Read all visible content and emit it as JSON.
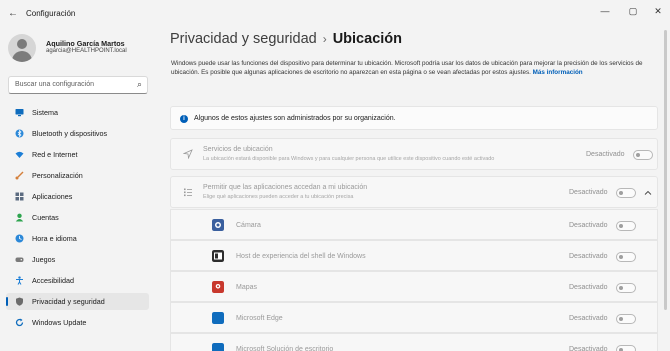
{
  "window": {
    "title": "Configuración",
    "back_icon": "←",
    "minimize": "—",
    "maximize": "▢",
    "close": "✕"
  },
  "user": {
    "name": "Aquilino García Martos",
    "email": "agarcia@HEALTHPOINT.local"
  },
  "search": {
    "placeholder": "Buscar una configuración",
    "icon": "⌕"
  },
  "nav": {
    "items": [
      {
        "label": "Sistema",
        "icon": "system-icon",
        "color": "#0f6cbd"
      },
      {
        "label": "Bluetooth y dispositivos",
        "icon": "bluetooth-icon",
        "color": "#2b88d8"
      },
      {
        "label": "Red e Internet",
        "icon": "wifi-icon",
        "color": "#1c7ed6"
      },
      {
        "label": "Personalización",
        "icon": "brush-icon",
        "color": "#d47f3a"
      },
      {
        "label": "Aplicaciones",
        "icon": "apps-icon",
        "color": "#5b6b80"
      },
      {
        "label": "Cuentas",
        "icon": "person-icon",
        "color": "#2ea44f"
      },
      {
        "label": "Hora e idioma",
        "icon": "clock-globe-icon",
        "color": "#2b88d8"
      },
      {
        "label": "Juegos",
        "icon": "gamepad-icon",
        "color": "#7a7a7a"
      },
      {
        "label": "Accesibilidad",
        "icon": "accessibility-icon",
        "color": "#1c7ed6"
      },
      {
        "label": "Privacidad y seguridad",
        "icon": "shield-icon",
        "color": "#6b6b6b",
        "active": true
      },
      {
        "label": "Windows Update",
        "icon": "update-icon",
        "color": "#0f6cbd"
      }
    ]
  },
  "header": {
    "parent": "Privacidad y seguridad",
    "separator": "›",
    "current": "Ubicación"
  },
  "intro": {
    "text": "Windows puede usar las funciones del dispositivo para determinar tu ubicación. Microsoft podría usar los datos de ubicación para mejorar la precisión de los servicios de ubicación. Es posible que algunas aplicaciones de escritorio no aparezcan en esta página o se vean afectadas por estos ajustes.",
    "more_link": "Más información"
  },
  "banner": {
    "icon": "i",
    "text": "Algunos de estos ajustes son administrados por su organización."
  },
  "location_services": {
    "title": "Servicios de ubicación",
    "subtitle": "La ubicación estará disponible para Windows y para cualquier persona que utilice este dispositivo cuando esté activado",
    "status": "Desactivado"
  },
  "app_access": {
    "title": "Permitir que las aplicaciones accedan a mi ubicación",
    "subtitle": "Elige qué aplicaciones pueden acceder a tu ubicación precisa",
    "status": "Desactivado",
    "expanded": true
  },
  "apps": [
    {
      "name": "Cámara",
      "status": "Desactivado",
      "color": "#3a5f9e"
    },
    {
      "name": "Host de experiencia del shell de Windows",
      "status": "Desactivado",
      "color": "#2d2d2d"
    },
    {
      "name": "Mapas",
      "status": "Desactivado",
      "color": "#c8382d"
    },
    {
      "name": "Microsoft Edge",
      "status": "Desactivado",
      "color": "#0f6cbd"
    },
    {
      "name": "Microsoft Solución de escritorio",
      "status": "Desactivado",
      "color": "#0f6cbd"
    }
  ]
}
